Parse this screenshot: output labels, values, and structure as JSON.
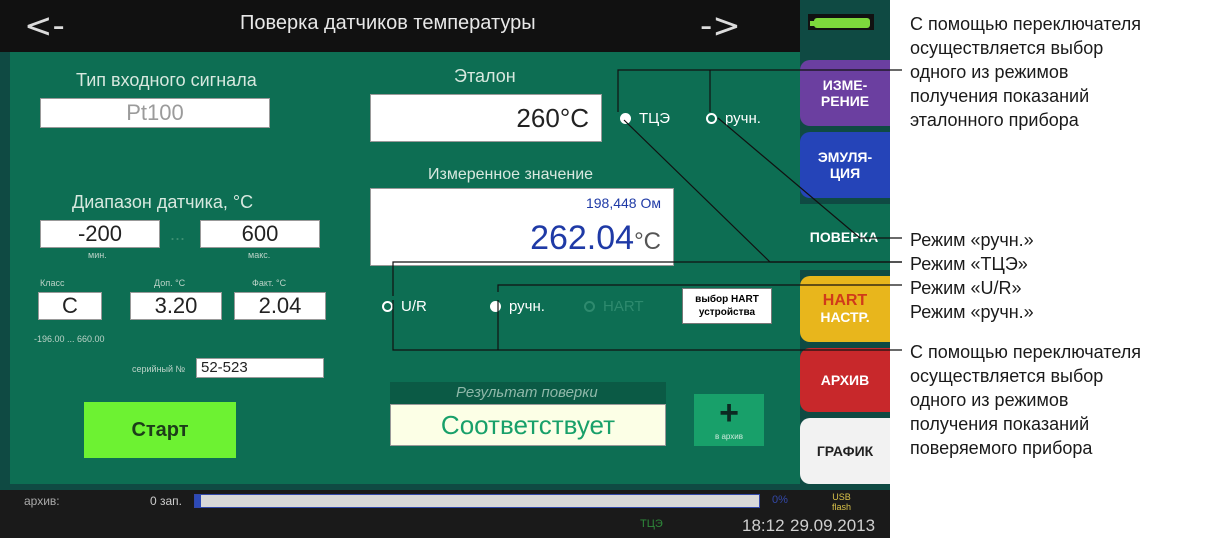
{
  "header": {
    "back_arrow": "<-",
    "forward_arrow": "->",
    "title": "Поверка датчиков температуры"
  },
  "input_signal": {
    "label": "Тип входного сигнала",
    "value": "Pt100"
  },
  "etalon": {
    "label": "Эталон",
    "value": "260",
    "unit": "°C",
    "radio_tce": "ТЦЭ",
    "radio_manual": "ручн."
  },
  "measured": {
    "label": "Измеренное значение",
    "ohm_value": "198,448 Ом",
    "value": "262.04",
    "unit": "°C"
  },
  "range": {
    "label": "Диапазон датчика, °C",
    "min_value": "-200",
    "max_value": "600",
    "min_caption": "мин.",
    "max_caption": "макс.",
    "separator": "...",
    "class_caption": "Класс",
    "dop_caption": "Доп. °C",
    "fact_caption": "Факт. °C",
    "class_value": "C",
    "dop_value": "3.20",
    "fact_value": "2.04",
    "limits": "-196.00 ... 660.00",
    "serial_label": "серийный №",
    "serial_value": "52-523"
  },
  "measure_mode": {
    "radio_ur": "U/R",
    "radio_manual": "ручн.",
    "radio_hart": "HART",
    "hart_button_line1": "выбор HART",
    "hart_button_line2": "устройства"
  },
  "result": {
    "label": "Результат поверки",
    "value": "Соответствует",
    "add_symbol": "+",
    "add_caption": "в архив"
  },
  "start_button": "Старт",
  "side_tabs": [
    {
      "line1": "ИЗМЕ-",
      "line2": "РЕНИЕ",
      "color": "#6b3fa0"
    },
    {
      "line1": "ЭМУЛЯ-",
      "line2": "ЦИЯ",
      "color": "#2544b8"
    },
    {
      "line1": "ПОВЕРКА",
      "line2": "",
      "color": "#0d6e53"
    },
    {
      "line1": "HART",
      "line2": "НАСТР.",
      "color": "#e8b61c"
    },
    {
      "line1": "АРХИВ",
      "line2": "",
      "color": "#c8282b"
    },
    {
      "line1": "ГРАФИК",
      "line2": "",
      "color": "#f2f2f2"
    }
  ],
  "statusbar": {
    "archive_label": "архив:",
    "records": "0 зап.",
    "progress_fraction": 0.0,
    "progress_percent": "0%",
    "usb_line1": "USB",
    "usb_line2": "flash",
    "tce": "ТЦЭ",
    "time": "18:12",
    "date": "29.09.2013"
  },
  "annotations": {
    "top": [
      "С помощью переключателя",
      "осуществляется выбор",
      "одного из режимов",
      "получения показаний",
      "эталонного прибора"
    ],
    "manual1": "Режим «ручн.»",
    "tce": "Режим «ТЦЭ»",
    "ur": "Режим «U/R»",
    "manual2": "Режим «ручн.»",
    "bottom": [
      "С помощью переключателя",
      "осуществляется выбор",
      "одного из режимов",
      "получения показаний",
      "поверяемого прибора"
    ]
  },
  "colors": {
    "panel": "#0d6e53",
    "accent_blue": "#1f3aa6",
    "start_green": "#6df232"
  }
}
